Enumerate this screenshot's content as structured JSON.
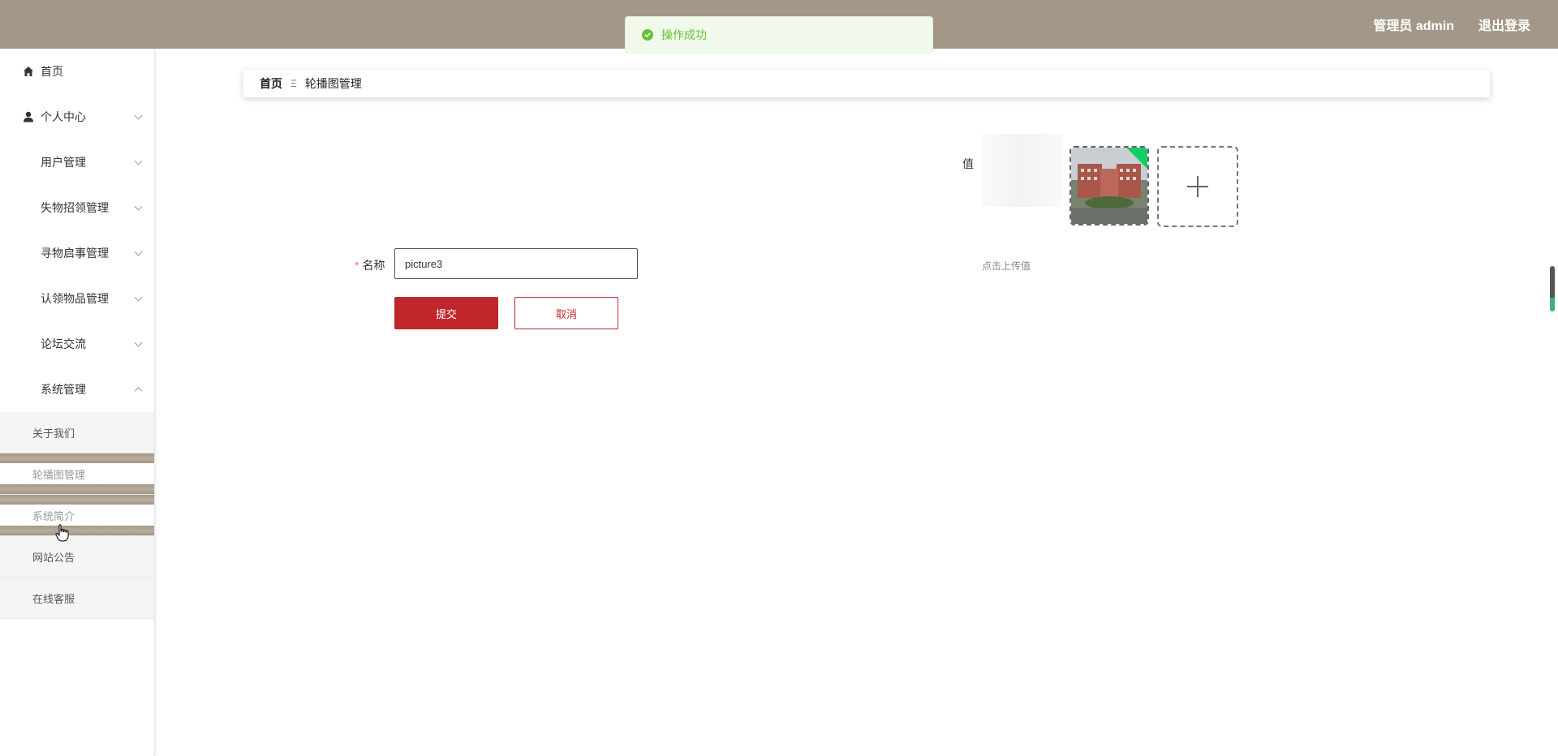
{
  "header": {
    "user_label": "管理员 admin",
    "logout_label": "退出登录"
  },
  "toast": {
    "message": "操作成功"
  },
  "sidebar": {
    "items": [
      {
        "label": "首页",
        "icon": "home-icon"
      },
      {
        "label": "个人中心",
        "icon": "user-icon"
      },
      {
        "label": "用户管理",
        "icon": "grid-icon"
      },
      {
        "label": "失物招领管理",
        "icon": "grid-icon"
      },
      {
        "label": "寻物启事管理",
        "icon": "grid-icon"
      },
      {
        "label": "认领物品管理",
        "icon": "grid-icon"
      },
      {
        "label": "论坛交流",
        "icon": "grid-icon"
      },
      {
        "label": "系统管理",
        "icon": "grid-icon"
      }
    ],
    "submenu": [
      {
        "label": "关于我们"
      },
      {
        "label": "轮播图管理"
      },
      {
        "label": "系统简介"
      },
      {
        "label": "网站公告"
      },
      {
        "label": "在线客服"
      }
    ]
  },
  "breadcrumb": {
    "home": "首页",
    "separator": "Ξ",
    "current": "轮播图管理"
  },
  "form": {
    "value_label": "值",
    "name_label": "名称",
    "name_value": "picture3",
    "upload_tip": "点击上传值",
    "submit_label": "提交",
    "cancel_label": "取消"
  },
  "colors": {
    "header_bg": "#a39887",
    "primary": "#c0272d",
    "success": "#67c23a"
  }
}
